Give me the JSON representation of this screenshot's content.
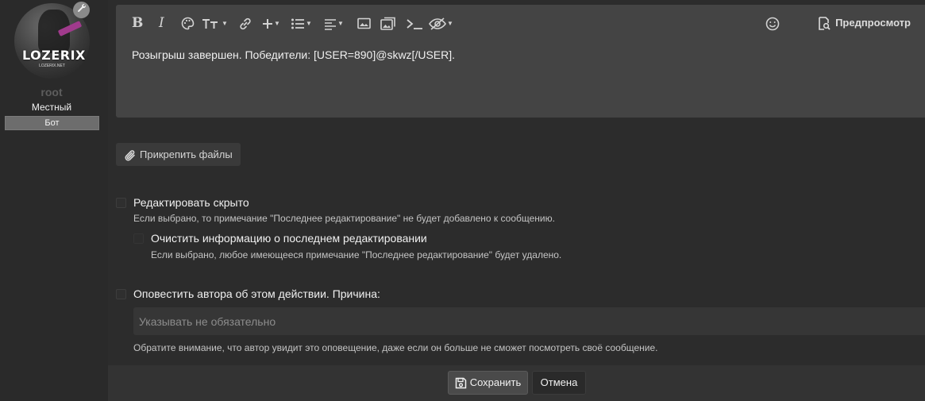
{
  "user": {
    "avatar_text": "LOZERIX",
    "avatar_subtext": "LOZERIX.NET",
    "username": "root",
    "title": "Местный",
    "banner": "Бот"
  },
  "toolbar": {
    "bold_label": "B",
    "italic_label": "I",
    "items": [
      "bold-icon",
      "italic-icon",
      "palette-icon",
      "font-size-icon",
      "link-icon",
      "insert-icon",
      "list-icon",
      "align-icon",
      "image-icon",
      "media-icon",
      "code-icon",
      "spoiler-icon",
      "smiley-icon"
    ],
    "preview_label": "Предпросмотр"
  },
  "editor": {
    "content": "Розыгрыш завершен. Победители: [USER=890]@skwz[/USER]."
  },
  "attach": {
    "label": "Прикрепить файлы"
  },
  "options": {
    "silent_edit": {
      "label": "Редактировать скрыто",
      "hint": "Если выбрано, то примечание \"Последнее редактирование\" не будет добавлено к сообщению."
    },
    "clear_edit": {
      "label": "Очистить информацию о последнем редактировании",
      "hint": "Если выбрано, любое имеющееся примечание \"Последнее редактирование\" будет удалено."
    },
    "notify_author": {
      "label": "Оповестить автора об этом действии. Причина:",
      "placeholder": "Указывать не обязательно",
      "hint": "Обратите внимание, что автор увидит это оповещение, даже если он больше не сможет посмотреть своё сообщение."
    }
  },
  "footer": {
    "save_label": "Сохранить",
    "cancel_label": "Отмена"
  },
  "colors": {
    "background": "#2c2c2c",
    "editor_bg": "#444444",
    "text": "#f0f0f0"
  }
}
